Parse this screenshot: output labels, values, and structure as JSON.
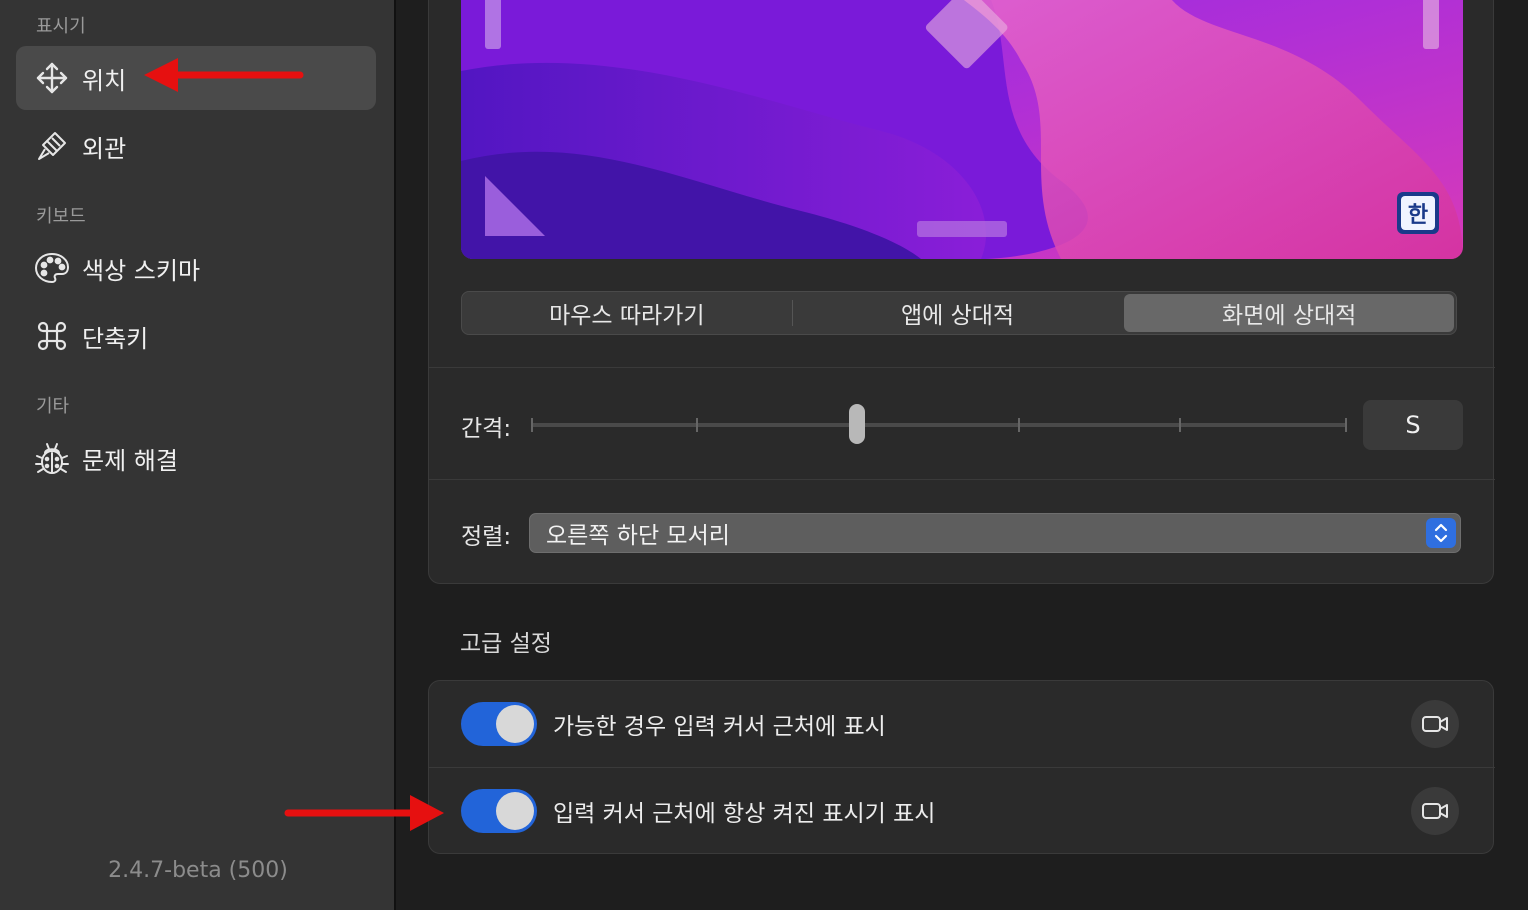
{
  "sidebar": {
    "sections": [
      {
        "label": "표시기"
      },
      {
        "label": "키보드"
      },
      {
        "label": "기타"
      }
    ],
    "items": [
      {
        "label": "위치",
        "icon": "move-arrows-icon",
        "selected": true
      },
      {
        "label": "외관",
        "icon": "paintbrush-icon"
      },
      {
        "label": "색상 스키마",
        "icon": "palette-icon"
      },
      {
        "label": "단축키",
        "icon": "command-icon"
      },
      {
        "label": "문제 해결",
        "icon": "bug-icon"
      }
    ],
    "version": "2.4.7-beta (500)"
  },
  "preview": {
    "indicator_text": "한"
  },
  "position_mode": {
    "options": [
      "마우스 따라가기",
      "앱에 상대적",
      "화면에 상대적"
    ],
    "selected": 2
  },
  "spacing": {
    "label": "간격:",
    "size_value": "S"
  },
  "alignment": {
    "label": "정렬:",
    "value": "오른쪽 하단 모서리"
  },
  "advanced": {
    "title": "고급 설정",
    "toggles": [
      {
        "label": "가능한 경우 입력 커서 근처에 표시",
        "on": true
      },
      {
        "label": "입력 커서 근처에 항상 켜진 표시기 표시",
        "on": true
      }
    ]
  },
  "colors": {
    "accent": "#2264d9",
    "annotation_arrow": "#e61010"
  }
}
